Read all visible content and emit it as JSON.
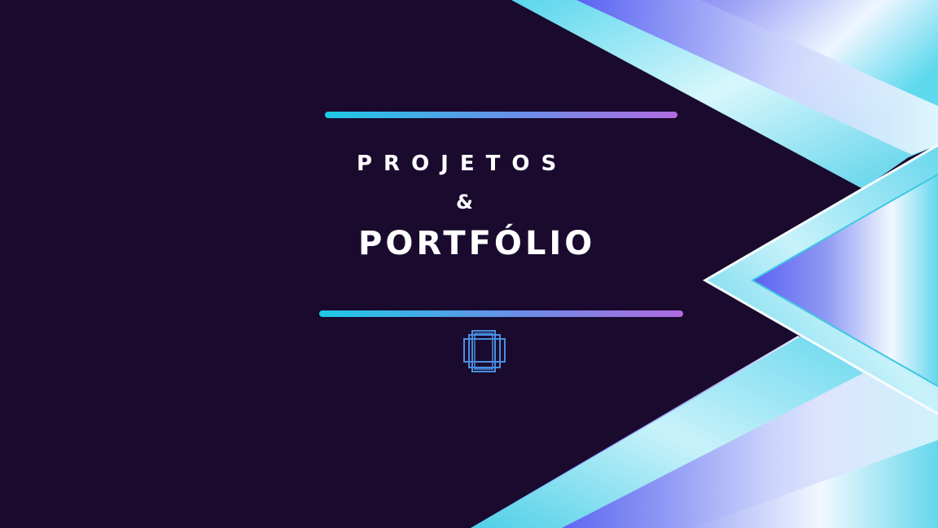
{
  "title": {
    "line1": "PROJETOS",
    "ampersand": "&",
    "line2": "PORTFÓLIO"
  },
  "colors": {
    "background": "#1a0a2e",
    "accent_cyan": "#1ec9e6",
    "accent_blue": "#6a8ee8",
    "accent_purple": "#b06be0",
    "text": "#ffffff"
  },
  "icons": {
    "logo": "overlapping-frames-icon"
  }
}
